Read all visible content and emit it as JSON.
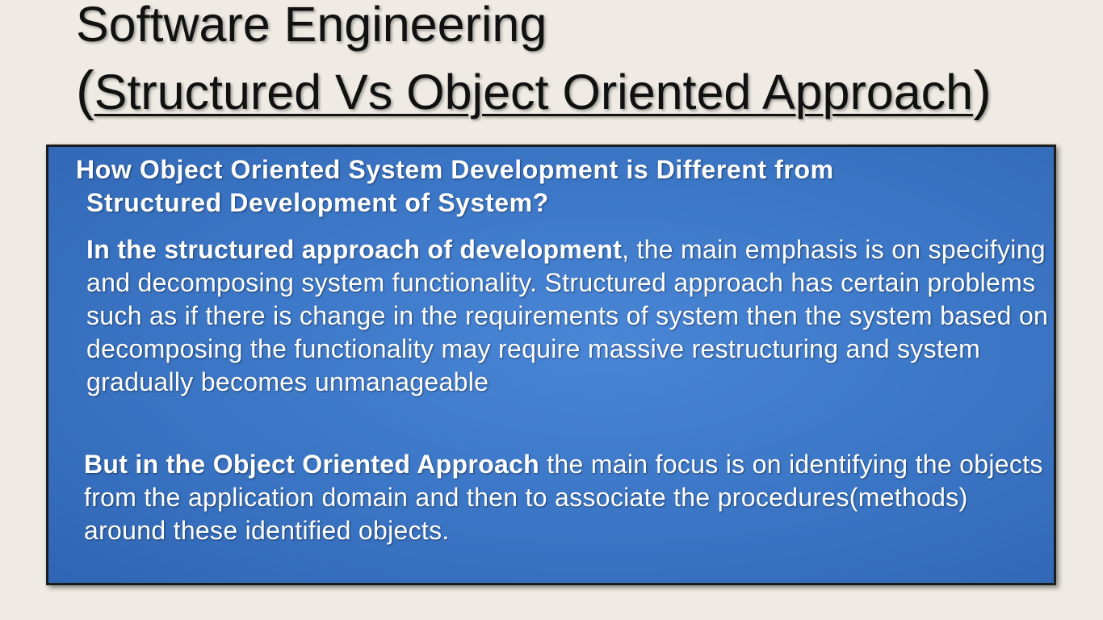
{
  "slide": {
    "title": "Software Engineering",
    "subtitle_open": "(",
    "subtitle_text": "Structured  Vs Object Oriented Approach",
    "subtitle_close": ")"
  },
  "box": {
    "question_line1": "How  Object Oriented System Development is Different from",
    "question_line2": "Structured Development of System?",
    "para1_bold": "In the structured approach of development",
    "para1_text": ", the  main emphasis is on specifying and decomposing  system functionality. Structured approach has certain problems  such as if there is change in the requirements of system then the system based on decomposing the functionality  may require massive restructuring and system gradually becomes unmanageable",
    "para2_bold": "But in the Object Oriented Approach",
    "para2_text": " the main focus is on identifying the objects from the application domain and then to associate the procedures(methods) around these identified objects."
  },
  "colors": {
    "background": "#efebe4",
    "box_fill": "#3d78c8",
    "text_on_box": "#ffffff"
  }
}
